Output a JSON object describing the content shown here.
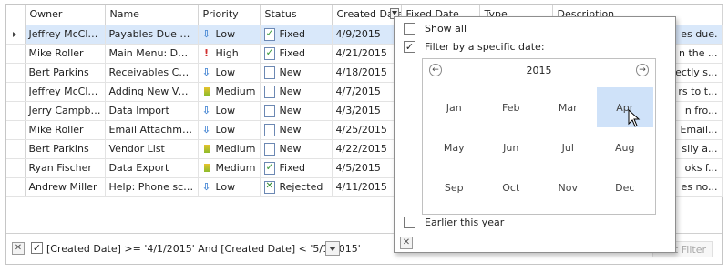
{
  "grid": {
    "columns": [
      "Owner",
      "Name",
      "Priority",
      "Status",
      "Created Date",
      "Fixed Date",
      "Type",
      "Description"
    ],
    "rows": [
      {
        "owner": "Jeffrey McClain",
        "name": "Payables Due Ca...",
        "priority": "Low",
        "status": "Fixed",
        "created": "4/9/2015",
        "desc": "es due."
      },
      {
        "owner": "Mike Roller",
        "name": "Main Menu: Dupli...",
        "priority": "High",
        "status": "Fixed",
        "created": "4/21/2015",
        "desc": "n the ..."
      },
      {
        "owner": "Bert Parkins",
        "name": "Receivables Calc...",
        "priority": "Low",
        "status": "New",
        "created": "4/18/2015",
        "desc": "ectly s..."
      },
      {
        "owner": "Jeffrey McClain",
        "name": "Adding New Ven...",
        "priority": "Medium",
        "status": "New",
        "created": "4/7/2015",
        "desc": "rs to t..."
      },
      {
        "owner": "Jerry Campbell",
        "name": "Data Import",
        "priority": "Low",
        "status": "New",
        "created": "4/3/2015",
        "desc": "n fro..."
      },
      {
        "owner": "Mike Roller",
        "name": "Email Attachments",
        "priority": "Low",
        "status": "New",
        "created": "4/25/2015",
        "desc": "Email..."
      },
      {
        "owner": "Bert Parkins",
        "name": "Vendor List",
        "priority": "Medium",
        "status": "New",
        "created": "4/22/2015",
        "desc": "sily a..."
      },
      {
        "owner": "Ryan Fischer",
        "name": "Data Export",
        "priority": "Medium",
        "status": "Fixed",
        "created": "4/5/2015",
        "desc": "oks f..."
      },
      {
        "owner": "Andrew Miller",
        "name": "Help: Phone scripts",
        "priority": "Low",
        "status": "Rejected",
        "created": "4/11/2015",
        "desc": "es no..."
      }
    ]
  },
  "filter_panel": {
    "text": "[Created Date] >= '4/1/2015' And [Created Date] < '5/1/2015'",
    "edit_label": "Edit Filter"
  },
  "popup": {
    "show_all": "Show all",
    "specific_date": "Filter by a specific date:",
    "year": "2015",
    "months": [
      "Jan",
      "Feb",
      "Mar",
      "Apr",
      "May",
      "Jun",
      "Jul",
      "Aug",
      "Sep",
      "Oct",
      "Nov",
      "Dec"
    ],
    "selected_month": "Apr",
    "earlier": "Earlier this year"
  },
  "colors": {
    "selection": "#d9e8fa",
    "month_selected": "#cfe2f9"
  },
  "icons": {
    "low": "arrow-down-icon",
    "high": "exclamation-icon",
    "medium": "medium-bar-icon",
    "fixed": "document-check-icon",
    "new": "document-icon",
    "rejected": "document-x-icon"
  }
}
